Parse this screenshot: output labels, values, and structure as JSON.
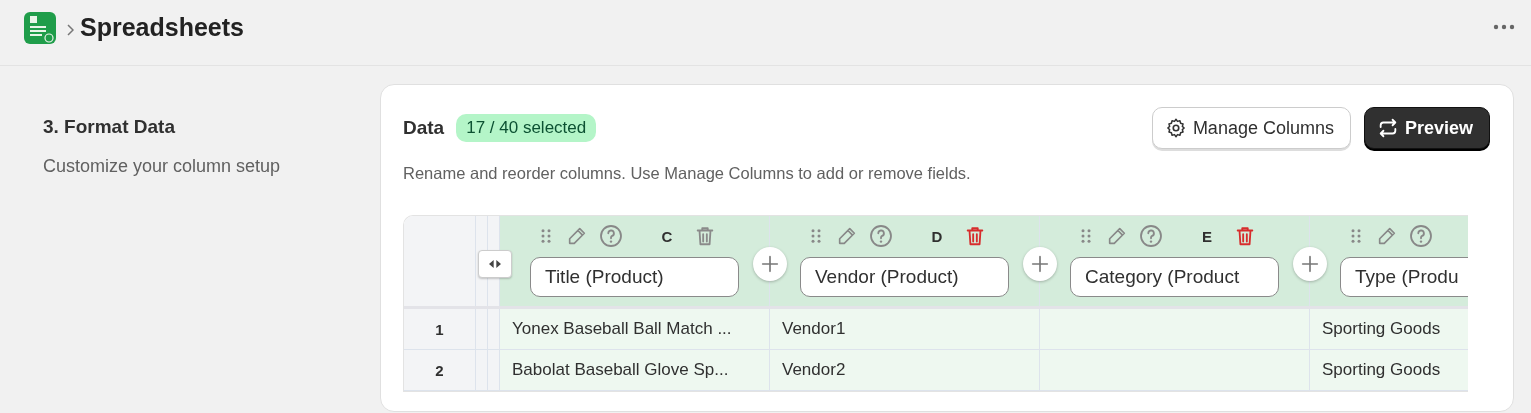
{
  "header": {
    "title": "Spreadsheets"
  },
  "step": {
    "title": "3. Format Data",
    "description": "Customize your column setup"
  },
  "card": {
    "title": "Data",
    "badge": "17 / 40 selected",
    "buttons": [
      {
        "kind": "secondary",
        "label": "Manage Columns"
      },
      {
        "kind": "primary",
        "label": "Preview"
      }
    ],
    "description": "Rename and reorder columns. Use Manage Columns to add or remove fields."
  },
  "table": {
    "columns": [
      {
        "letter": "C",
        "name": "Title (Product)",
        "delete_highlighted": false
      },
      {
        "letter": "D",
        "name": "Vendor (Product)",
        "delete_highlighted": true
      },
      {
        "letter": "E",
        "name": "Category (Product",
        "delete_highlighted": true
      },
      {
        "name": "Type (Produ"
      }
    ],
    "rows": [
      {
        "number": "1",
        "cells": [
          "Yonex Baseball Ball Match ...",
          "Vendor1",
          null,
          "Sporting Goods"
        ]
      },
      {
        "number": "2",
        "cells": [
          "Babolat Baseball Glove Sp...",
          "Vendor2",
          null,
          "Sporting Goods"
        ]
      }
    ]
  }
}
